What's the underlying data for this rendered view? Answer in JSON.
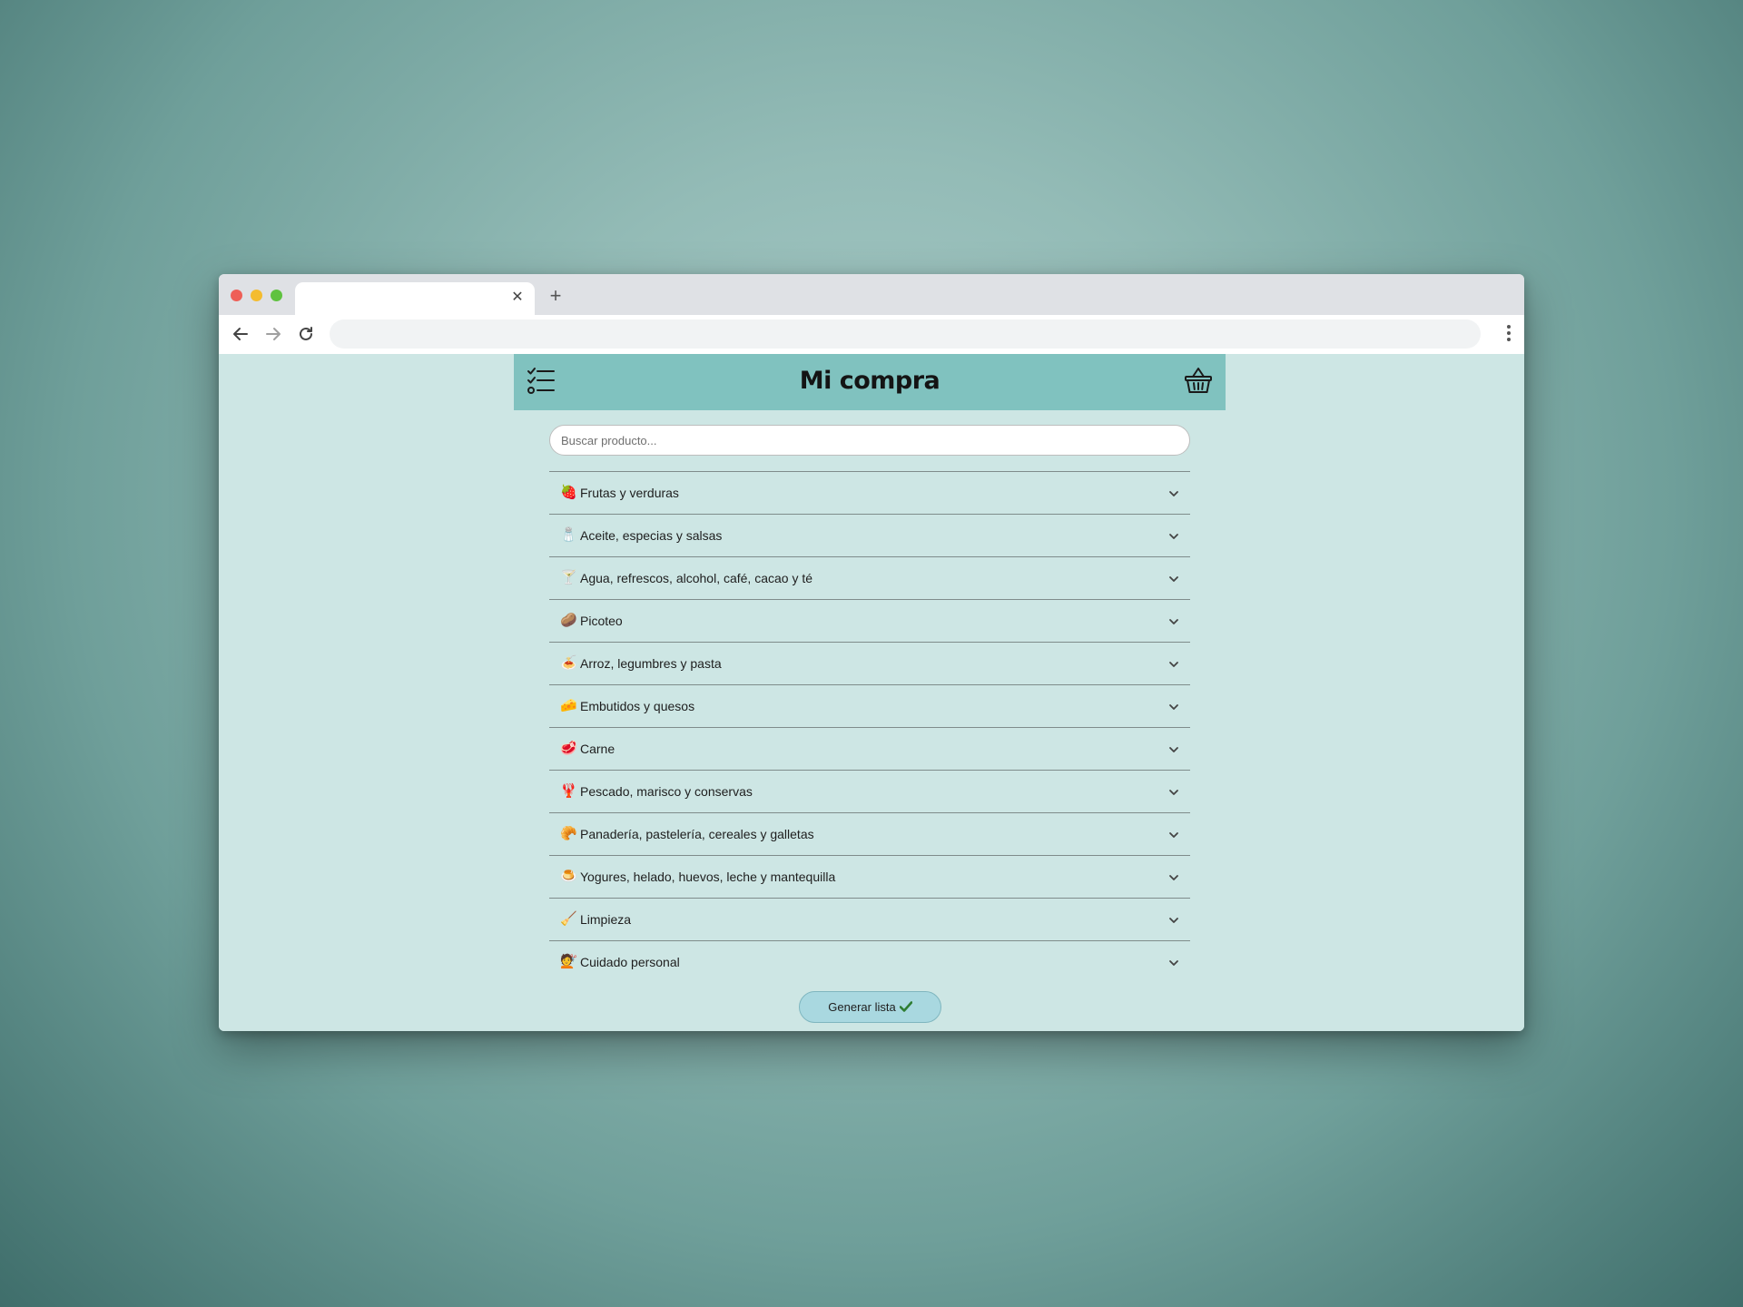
{
  "browser": {
    "tab_close_glyph": "✕",
    "new_tab_glyph": "+",
    "address": ""
  },
  "header": {
    "title": "Mi compra",
    "left_icon": "checklist-icon",
    "right_icon": "basket-icon",
    "bg_color": "#80c2bf"
  },
  "search": {
    "placeholder": "Buscar producto...",
    "value": ""
  },
  "categories": [
    {
      "emoji": "🍓",
      "label": "Frutas y verduras"
    },
    {
      "emoji": "🧂",
      "label": "Aceite, especias y salsas"
    },
    {
      "emoji": "🍸",
      "label": "Agua, refrescos, alcohol, café, cacao y té"
    },
    {
      "emoji": "🥔",
      "label": "Picoteo"
    },
    {
      "emoji": "🍝",
      "label": "Arroz, legumbres y pasta"
    },
    {
      "emoji": "🧀",
      "label": "Embutidos y quesos"
    },
    {
      "emoji": "🥩",
      "label": "Carne"
    },
    {
      "emoji": "🦞",
      "label": "Pescado, marisco y conservas"
    },
    {
      "emoji": "🥐",
      "label": "Panadería, pastelería, cereales y galletas"
    },
    {
      "emoji": "🍮",
      "label": "Yogures, helado, huevos, leche y mantequilla"
    },
    {
      "emoji": "🧹",
      "label": "Limpieza"
    },
    {
      "emoji": "💇",
      "label": "Cuidado personal"
    }
  ],
  "generate_button": {
    "label": "Generar lista",
    "icon": "check-icon"
  },
  "colors": {
    "page_bg": "#cde6e4",
    "accent": "#80c2bf",
    "button_bg": "#a9d8e0",
    "check": "#2e7d32"
  }
}
